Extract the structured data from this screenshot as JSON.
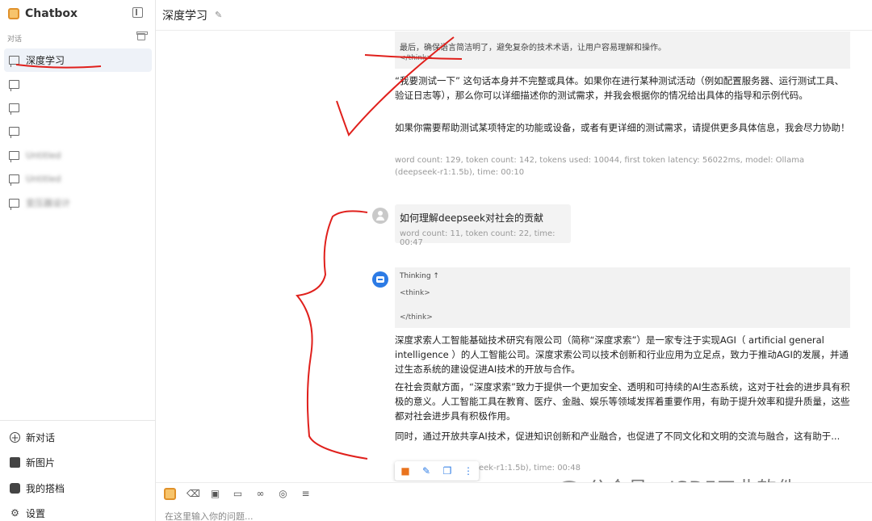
{
  "app": {
    "name": "Chatbox"
  },
  "sidebar": {
    "section_label": "对话",
    "conversations": [
      {
        "label": "深度学习",
        "active": true,
        "blurred": false
      },
      {
        "label": "",
        "active": false,
        "blurred": false
      },
      {
        "label": "",
        "active": false,
        "blurred": false
      },
      {
        "label": "",
        "active": false,
        "blurred": false
      },
      {
        "label": "Untitled",
        "active": false,
        "blurred": true
      },
      {
        "label": "Untitled",
        "active": false,
        "blurred": true
      },
      {
        "label": "变压器设计",
        "active": false,
        "blurred": true
      }
    ],
    "actions": {
      "new_chat": "新对话",
      "new_image": "新图片",
      "my_copilots": "我的搭档",
      "settings": "设置"
    }
  },
  "header": {
    "title": "深度学习"
  },
  "messages": {
    "prev_thinking": {
      "text": "最后，确保语言简洁明了，避免复杂的技术术语，让用户容易理解和操作。",
      "tag": "</think>"
    },
    "prev_reply": {
      "para1": "“我要测试一下” 这句话本身并不完整或具体。如果你在进行某种测试活动（例如配置服务器、运行测试工具、验证日志等），那么你可以详细描述你的测试需求，并我会根据你的情况给出具体的指导和示例代码。",
      "para2": "如果你需要帮助测试某项特定的功能或设备，或者有更详细的测试需求，请提供更多具体信息，我会尽力协助！",
      "meta": "word count: 129, token count: 142, tokens used: 10044, first token latency: 56022ms, model: Ollama (deepseek-r1:1.5b), time: 00:10"
    },
    "user": {
      "text": "如何理解deepseek对社会的贡献",
      "meta": "word count: 11, token count: 22, time: 00:47"
    },
    "assistant": {
      "thinking_label": "Thinking",
      "think_open": "<think>",
      "think_close": "</think>",
      "para1": "深度求索人工智能基础技术研究有限公司（简称“深度求索”）是一家专注于实现AGI（ artificial general intelligence ）的人工智能公司。深度求索公司以技术创新和行业应用为立足点，致力于推动AGI的发展，并通过生态系统的建设促进AI技术的开放与合作。",
      "para2": "在社会贡献方面，“深度求索”致力于提供一个更加安全、透明和可持续的AI生态系统，这对于社会的进步具有积极的意义。人工智能工具在教育、医疗、金融、娱乐等领域发挥着重要作用，有助于提升效率和提升质量，这些都对社会进步具有积极作用。",
      "para3": "同时，通过开放共享AI技术，促进知识创新和产业融合，也促进了不同文化和文明的交流与融合，这有助于...",
      "meta_partial": "eek-r1:1.5b), time: 00:48"
    }
  },
  "input": {
    "placeholder": "在这里输入你的问题..."
  },
  "watermark": "公众号 · ISDF工业软件",
  "icons": {
    "collapse": "sidebar-collapse-icon",
    "archive": "archive-icon",
    "edit": "pencil-icon",
    "stop": "stop-icon",
    "copy": "copy-icon",
    "more": "more-vertical-icon"
  },
  "colors": {
    "accent": "#2c7be5",
    "stop": "#e9731e",
    "annotation": "#e0201c"
  }
}
